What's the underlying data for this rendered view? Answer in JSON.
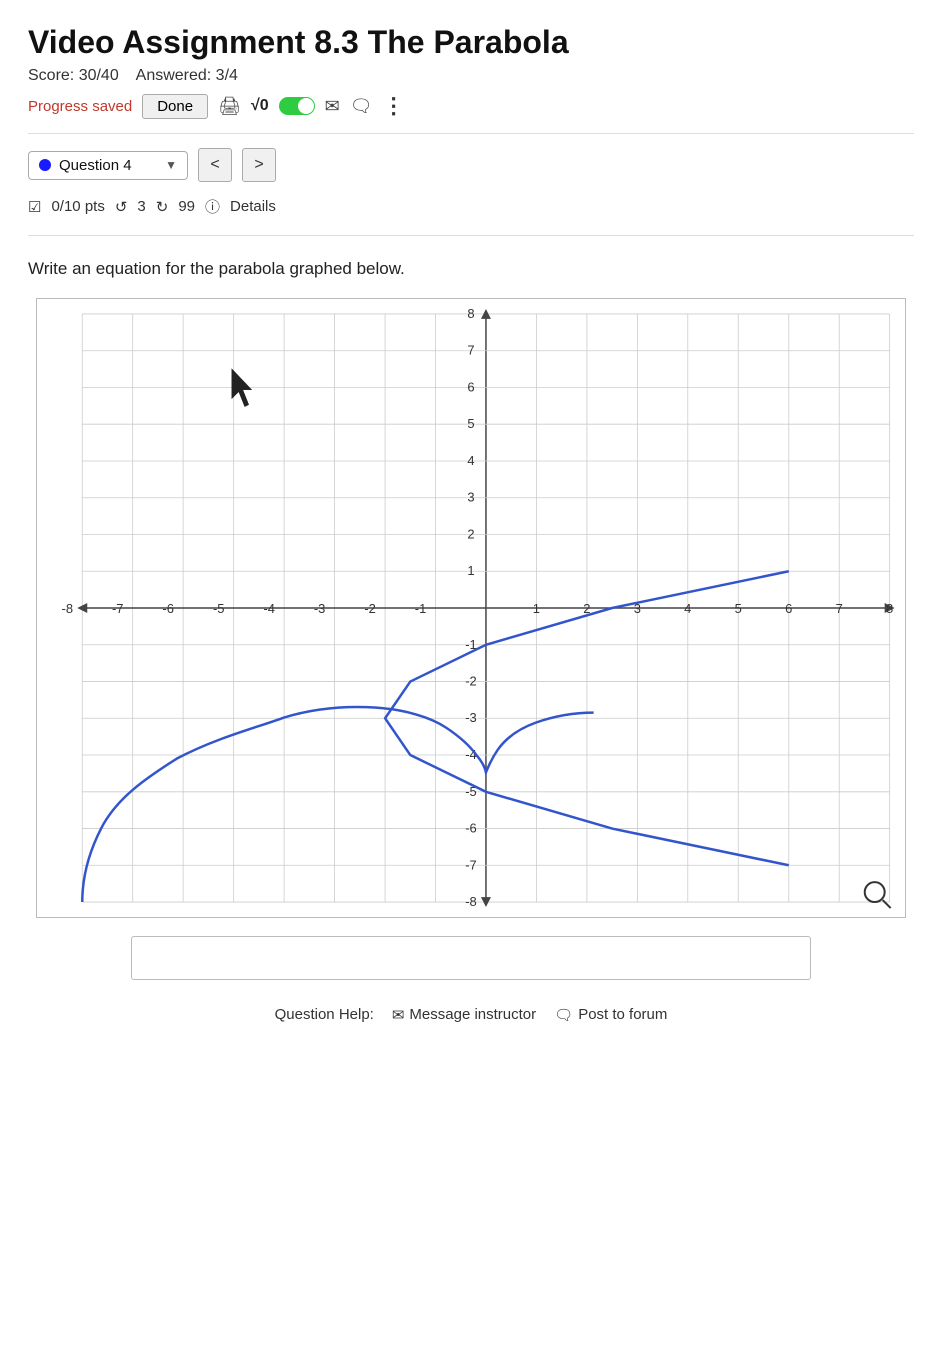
{
  "header": {
    "title": "Video Assignment 8.3 The Parabola",
    "score": "Score: 30/40",
    "answered": "Answered: 3/4",
    "progress_saved": "Progress saved",
    "done_label": "Done"
  },
  "toolbar": {
    "print_icon": "🖨",
    "sqrt_label": "√0",
    "mail_icon": "✉",
    "chat_icon": "🗨",
    "more_icon": "⋮"
  },
  "question_nav": {
    "dot_color": "#1a1aff",
    "label": "Question 4",
    "prev_label": "<",
    "next_label": ">"
  },
  "pts_row": {
    "checkbox_icon": "☑",
    "pts_label": "0/10 pts",
    "undo_icon": "↺",
    "undo_count": "3",
    "retry_icon": "↻",
    "retry_count": "99",
    "info_icon": "ⓘ",
    "details_label": "Details"
  },
  "question": {
    "text": "Write an equation for the parabola graphed below."
  },
  "answer": {
    "placeholder": ""
  },
  "question_help": {
    "label": "Question Help:",
    "message_instructor": "Message instructor",
    "post_to_forum": "Post to forum",
    "mail_icon": "✉",
    "forum_icon": "🗨"
  },
  "graph": {
    "x_min": -8,
    "x_max": 8,
    "y_min": -8,
    "y_max": 8,
    "x_labels": [
      "-8",
      "-7",
      "-6",
      "-5",
      "-4",
      "-3",
      "-2",
      "-1",
      "1",
      "2",
      "3",
      "4",
      "5",
      "6",
      "7",
      "8"
    ],
    "y_labels": [
      "8",
      "7",
      "6",
      "5",
      "4",
      "3",
      "2",
      "1",
      "-1",
      "-2",
      "-3",
      "-4",
      "-5",
      "-6",
      "-7",
      "-8"
    ]
  }
}
